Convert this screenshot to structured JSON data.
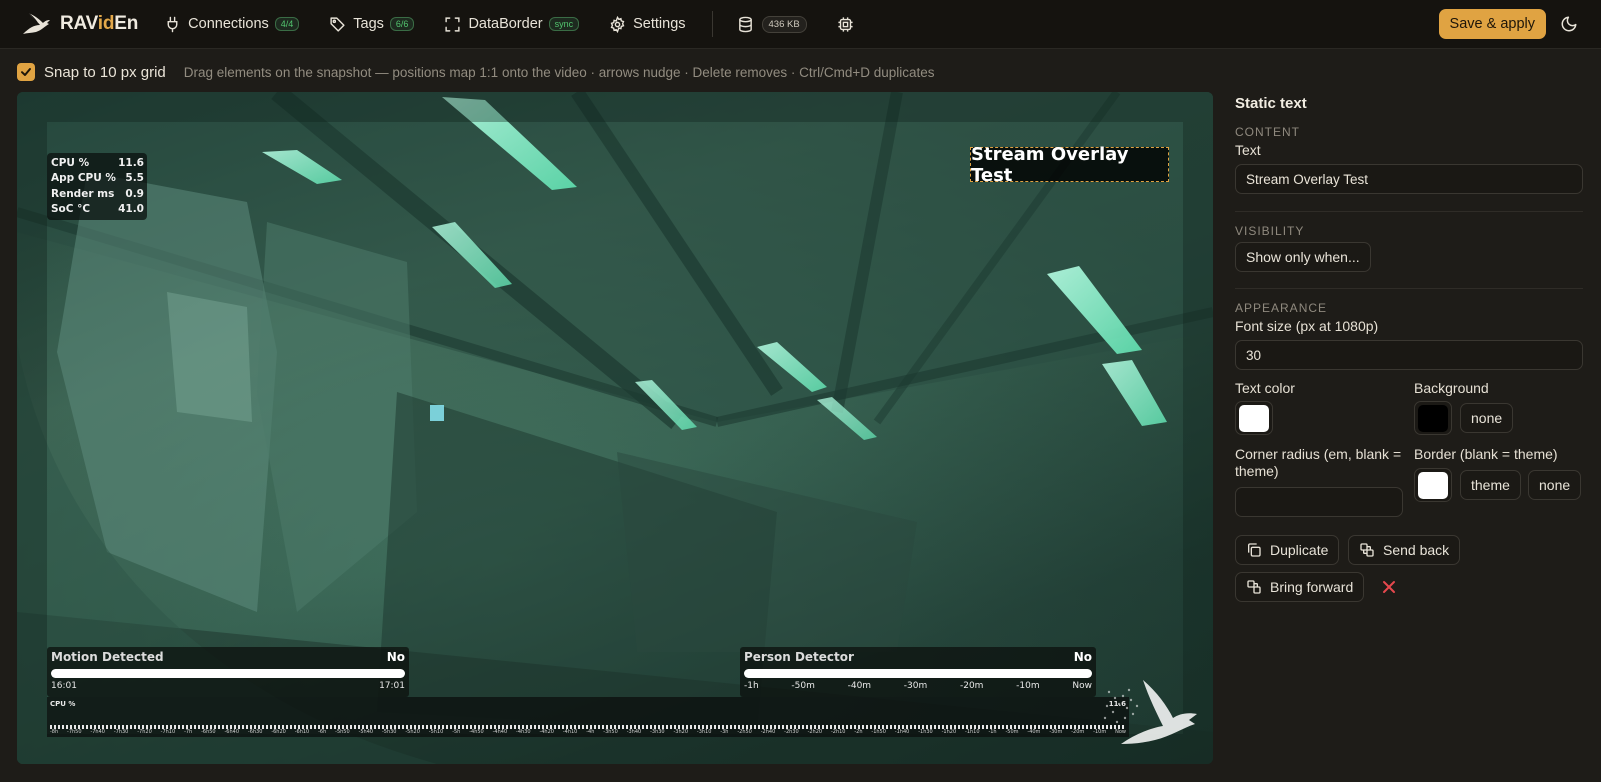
{
  "app": {
    "name_prefix": "RAV",
    "name_accent": "id",
    "name_suffix": "En"
  },
  "nav": {
    "connections": {
      "label": "Connections",
      "badge": "4/4"
    },
    "tags": {
      "label": "Tags",
      "badge": "6/6"
    },
    "databorder": {
      "label": "DataBorder",
      "badge": "sync"
    },
    "settings": {
      "label": "Settings"
    },
    "storage": "436 KB"
  },
  "toolbar": {
    "save_label": "Save & apply"
  },
  "snap": {
    "checked": true,
    "label": "Snap to 10 px grid",
    "hint": "Drag elements on the snapshot — positions map 1:1 onto the video · arrows nudge · Delete removes · Ctrl/Cmd+D duplicates"
  },
  "overlay": {
    "stats": [
      {
        "label": "CPU %",
        "value": "11.6"
      },
      {
        "label": "App CPU %",
        "value": "5.5"
      },
      {
        "label": "Render ms",
        "value": "0.9"
      },
      {
        "label": "SoC °C",
        "value": "41.0"
      }
    ],
    "static_text": "Stream Overlay Test",
    "motion": {
      "title": "Motion Detected",
      "value": "No",
      "t_start": "16:01",
      "t_end": "17:01"
    },
    "person": {
      "title": "Person Detector",
      "value": "No",
      "ticks": [
        "-1h",
        "-50m",
        "-40m",
        "-30m",
        "-20m",
        "-10m",
        "Now"
      ]
    },
    "cpu": {
      "label": "CPU %",
      "value": "11.6",
      "ticks": [
        "-8h",
        "-7h50",
        "-7h40",
        "-7h30",
        "-7h20",
        "-7h10",
        "-7h",
        "-6h50",
        "-6h40",
        "-6h30",
        "-6h20",
        "-6h10",
        "-6h",
        "-5h50",
        "-5h40",
        "-5h30",
        "-5h20",
        "-5h10",
        "-5h",
        "-4h50",
        "-4h40",
        "-4h30",
        "-4h20",
        "-4h10",
        "-4h",
        "-3h50",
        "-3h40",
        "-3h30",
        "-3h20",
        "-3h10",
        "-3h",
        "-2h50",
        "-2h40",
        "-2h30",
        "-2h20",
        "-2h10",
        "-2h",
        "-1h50",
        "-1h40",
        "-1h30",
        "-1h20",
        "-1h10",
        "-1h",
        "-50m",
        "-40m",
        "-30m",
        "-20m",
        "-10m",
        "Now"
      ]
    }
  },
  "panel": {
    "title": "Static text",
    "content_section": "CONTENT",
    "text_label": "Text",
    "text_value": "Stream Overlay Test",
    "visibility_section": "VISIBILITY",
    "visibility_button": "Show only when...",
    "appearance_section": "APPEARANCE",
    "font_size_label": "Font size (px at 1080p)",
    "font_size_value": "30",
    "text_color_label": "Text color",
    "text_color": "#ffffff",
    "background_label": "Background",
    "background_color": "#000000",
    "background_none": "none",
    "corner_radius_label": "Corner radius (em, blank = theme)",
    "corner_radius_value": "",
    "border_label": "Border (blank = theme)",
    "border_color": "#ffffff",
    "border_theme": "theme",
    "border_none": "none",
    "duplicate_label": "Duplicate",
    "send_back_label": "Send back",
    "bring_forward_label": "Bring forward"
  },
  "colors": {
    "accent": "#e0a342",
    "badge_green": "#52c46e",
    "delete_red": "#e5484d"
  }
}
